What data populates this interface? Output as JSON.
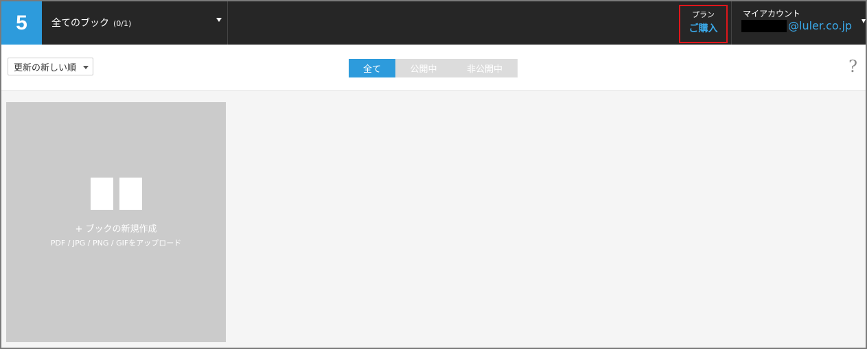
{
  "topbar": {
    "logo": "5",
    "book_selector": {
      "title": "全てのブック",
      "count": "(0/1)"
    },
    "plan": {
      "label": "プラン",
      "action": "ご購入"
    },
    "account": {
      "label": "マイアカウント",
      "email_domain": "@luler.co.jp"
    }
  },
  "toolbar": {
    "sort_label": "更新の新しい順",
    "filters": [
      {
        "label": "全て",
        "active": true
      },
      {
        "label": "公開中",
        "active": false
      },
      {
        "label": "非公開中",
        "active": false
      }
    ],
    "help": "?"
  },
  "new_book_card": {
    "create_label": "+ ブックの新規作成",
    "upload_label": "PDF / JPG / PNG / GIFをアップロード"
  },
  "colors": {
    "accent": "#2d9bdc",
    "topbar_bg": "#262626",
    "highlight_border": "#e0161b",
    "link": "#3aa8e8"
  }
}
